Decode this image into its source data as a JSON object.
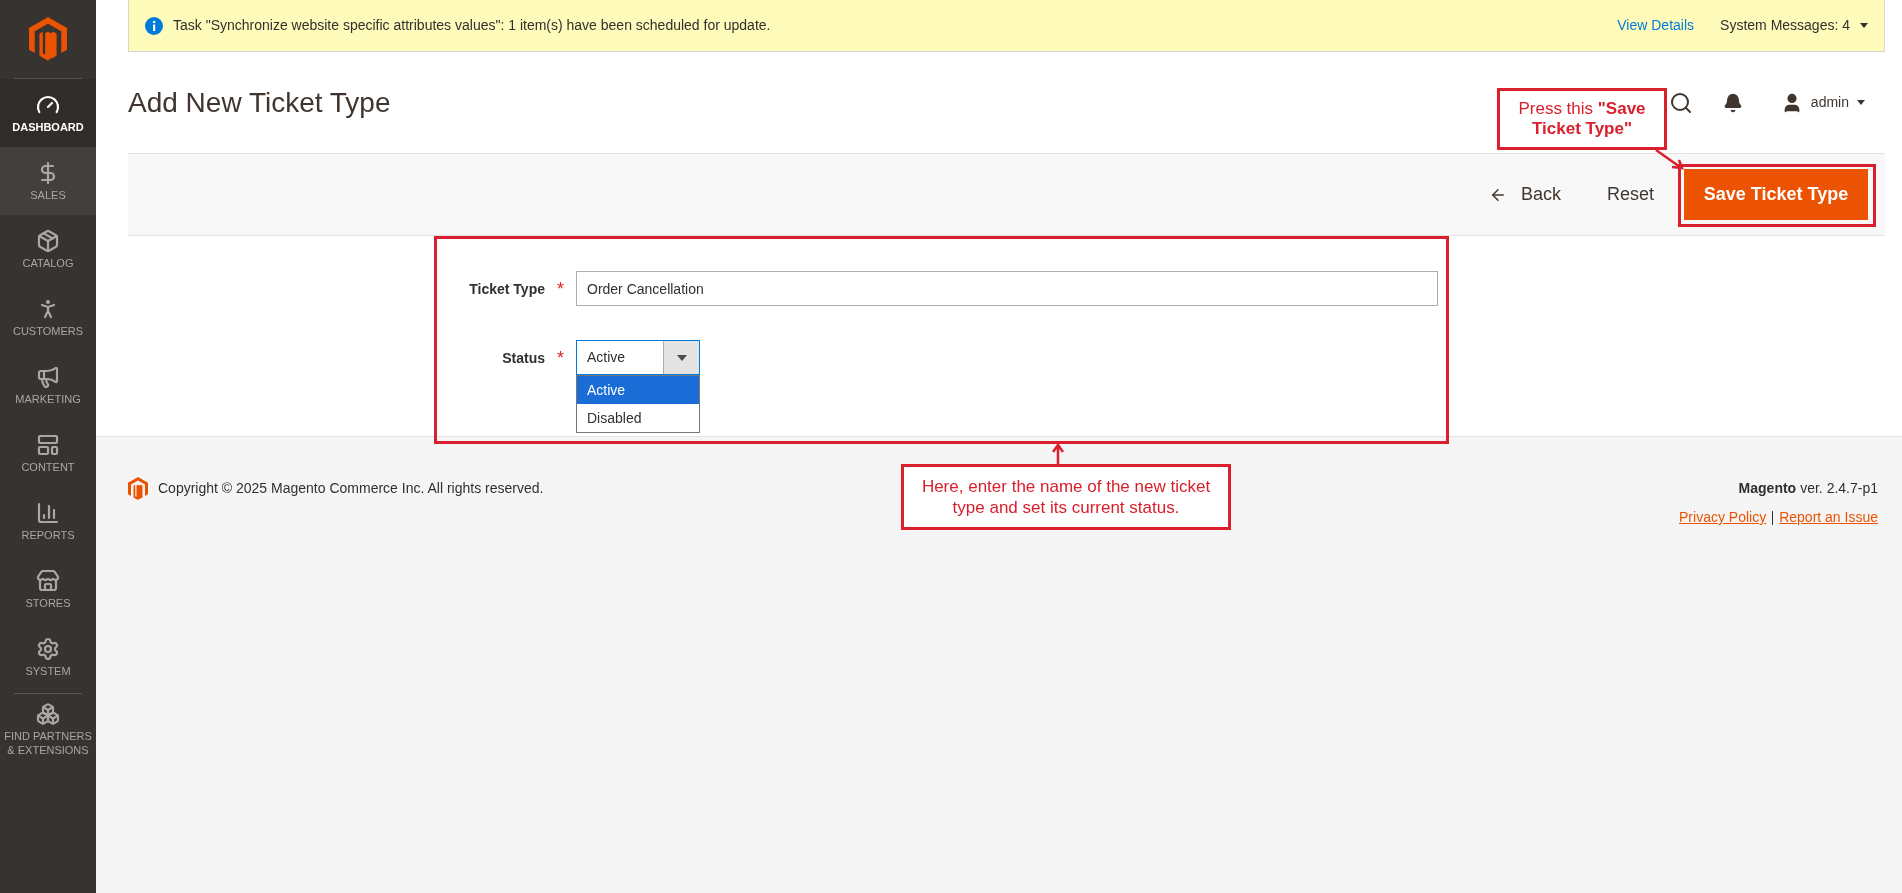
{
  "sidebar": {
    "items": [
      {
        "label": "DASHBOARD",
        "selected": true,
        "highlighted": false
      },
      {
        "label": "SALES",
        "selected": false,
        "highlighted": true
      },
      {
        "label": "CATALOG",
        "selected": false,
        "highlighted": false
      },
      {
        "label": "CUSTOMERS",
        "selected": false,
        "highlighted": false
      },
      {
        "label": "MARKETING",
        "selected": false,
        "highlighted": false
      },
      {
        "label": "CONTENT",
        "selected": false,
        "highlighted": false
      },
      {
        "label": "REPORTS",
        "selected": false,
        "highlighted": false
      },
      {
        "label": "STORES",
        "selected": false,
        "highlighted": false
      },
      {
        "label": "SYSTEM",
        "selected": false,
        "highlighted": false
      },
      {
        "label": "FIND PARTNERS & EXTENSIONS",
        "selected": false,
        "highlighted": false
      }
    ]
  },
  "notice": {
    "message": "Task \"Synchronize website specific attributes values\": 1 item(s) have been scheduled for update.",
    "link": "View Details",
    "system_messages": "System Messages: 4"
  },
  "header": {
    "title": "Add New Ticket Type",
    "user": "admin"
  },
  "actions": {
    "back": "Back",
    "reset": "Reset",
    "save": "Save Ticket Type"
  },
  "form": {
    "fields": [
      {
        "kind": "text",
        "label": "Ticket Type",
        "required_mark": "*",
        "value": "Order Cancellation"
      },
      {
        "kind": "select",
        "label": "Status",
        "required_mark": "*",
        "value": "Active",
        "expanded": true,
        "options": [
          {
            "label": "Active",
            "selected": true
          },
          {
            "label": "Disabled",
            "selected": false
          }
        ]
      }
    ]
  },
  "footer": {
    "copyright": "Copyright © 2025 Magento Commerce Inc. All rights reserved.",
    "brand": "Magento",
    "version": "ver. 2.4.7-p1",
    "links": [
      "Privacy Policy",
      "Report an Issue"
    ]
  },
  "annotations": {
    "save_callout": "Press this **\"Save Ticket Type\"**",
    "form_callout": "Here, enter the name of the new ticket type and set its current status."
  }
}
